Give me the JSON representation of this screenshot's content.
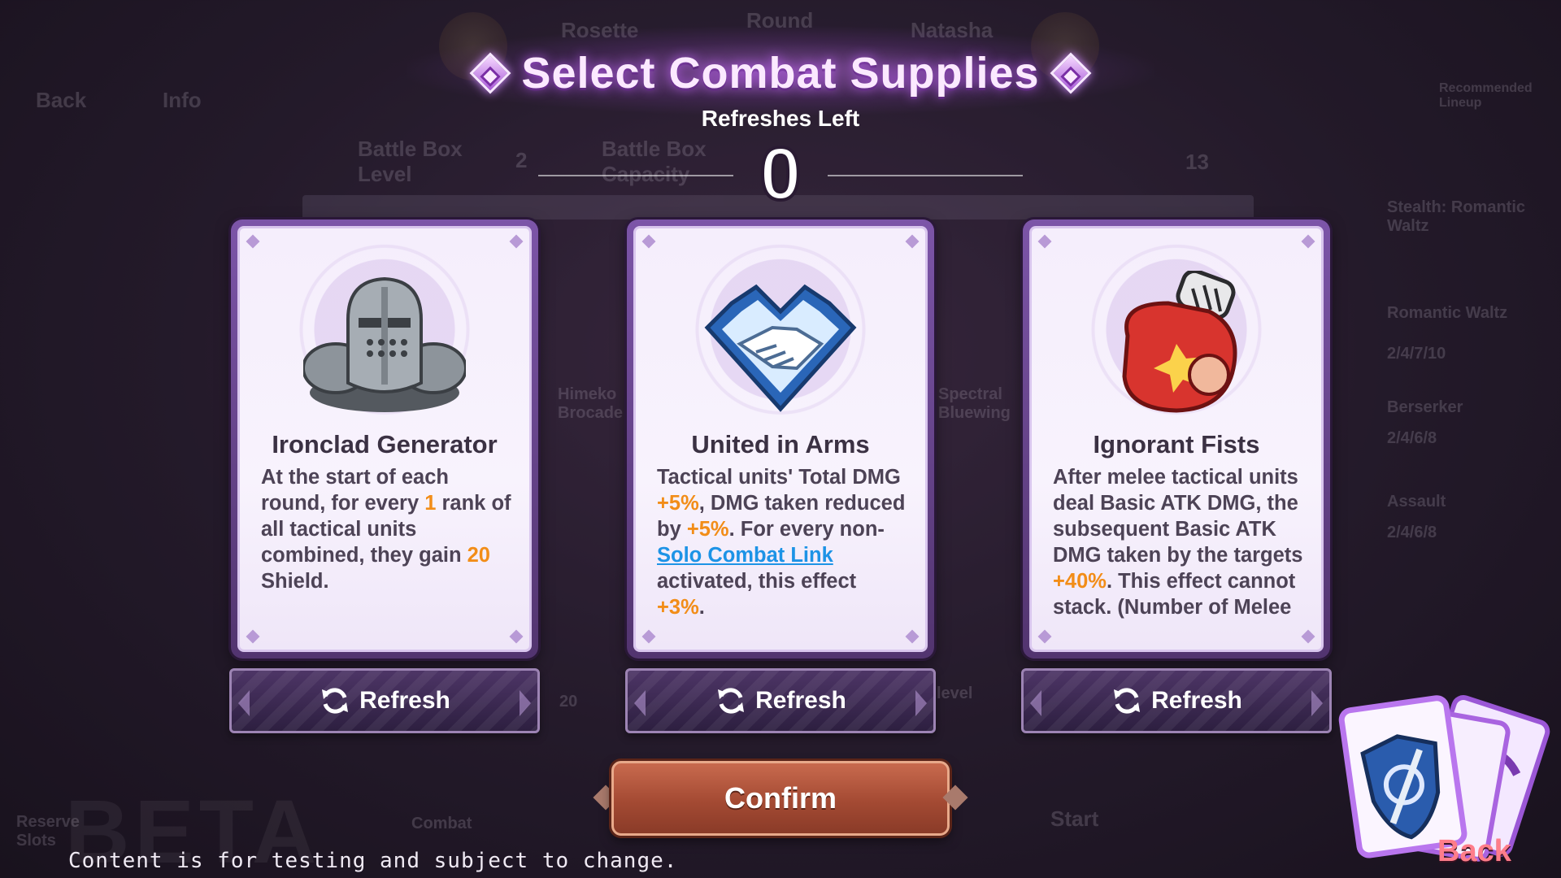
{
  "background": {
    "top_nav": {
      "back": "Back",
      "info": "Info"
    },
    "players": {
      "left": "Rosette",
      "center": "Round",
      "right": "Natasha"
    },
    "battle_box_level_label": "Battle Box Level",
    "battle_box_level_value": "2",
    "battle_box_capacity_label": "Battle Box Capacity",
    "coins": "13",
    "right_list": [
      "Stealth: Romantic Waltz",
      "Romantic Waltz",
      "2/4/7/10",
      "Berserker",
      "2/4/6/8",
      "Assault",
      "2/4/6/8"
    ],
    "left_bottom": "Reserve Slots",
    "mid_bottom": "Combat",
    "start_label": "Start",
    "units": [
      "Himeko Brocade",
      "Spectral Bluewing"
    ],
    "level_label": "level",
    "misc_number": "20",
    "recommend": "Recommended Lineup"
  },
  "header": {
    "title": "Select Combat Supplies",
    "refreshes_label": "Refreshes Left",
    "refreshes_count": "0"
  },
  "cards": [
    {
      "name": "Ironclad Generator",
      "icon": "armored-helmet-icon",
      "desc": [
        {
          "t": "At the start of each round, for every "
        },
        {
          "t": "1",
          "hl": true
        },
        {
          "t": " rank of all tactical units combined, they gain "
        },
        {
          "t": "20",
          "hl": true
        },
        {
          "t": " Shield."
        }
      ]
    },
    {
      "name": "United in Arms",
      "icon": "handshake-heart-icon",
      "desc": [
        {
          "t": "Tactical units' Total DMG "
        },
        {
          "t": "+5%",
          "hl": true
        },
        {
          "t": ", DMG taken reduced by "
        },
        {
          "t": "+5%",
          "hl": true
        },
        {
          "t": ". For every non-"
        },
        {
          "t": "Solo Combat Link",
          "link": true
        },
        {
          "t": " activated, this effect "
        },
        {
          "t": "+3%",
          "hl": true
        },
        {
          "t": "."
        }
      ]
    },
    {
      "name": "Ignorant Fists",
      "icon": "boxing-glove-icon",
      "desc": [
        {
          "t": "After melee tactical units deal Basic ATK DMG, the subsequent Basic ATK DMG taken by the targets "
        },
        {
          "t": "+40%",
          "hl": true
        },
        {
          "t": ". This effect cannot stack. (Number of Melee"
        }
      ]
    }
  ],
  "buttons": {
    "refresh_label": "Refresh",
    "confirm_label": "Confirm",
    "back_label": "Back"
  },
  "footer": {
    "watermark": "BETA",
    "disclaimer": "Content is for testing and subject to change."
  },
  "colors": {
    "highlight": "#f28d18",
    "link": "#1d93e6",
    "title": "#fbe9ff",
    "back": "#ff7d8a"
  }
}
